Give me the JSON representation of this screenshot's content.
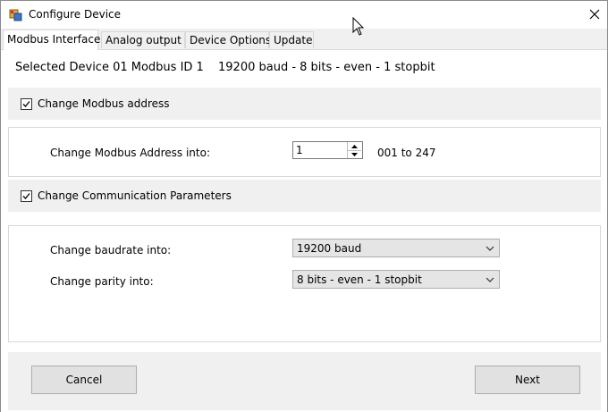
{
  "window": {
    "title": "Configure Device"
  },
  "tabs": [
    {
      "label": "Modbus Interface"
    },
    {
      "label": "Analog output"
    },
    {
      "label": "Device Options"
    },
    {
      "label": "Update"
    }
  ],
  "device": {
    "selected": "Selected Device 01 Modbus ID 1",
    "params": "19200 baud - 8 bits - even - 1 stopbit"
  },
  "address_section": {
    "checkbox_label": "Change Modbus address",
    "checked": true,
    "field_label": "Change Modbus Address into:",
    "value": "1",
    "range_text": "001 to 247"
  },
  "comm_section": {
    "checkbox_label": "Change Communication Parameters",
    "checked": true,
    "baud_label": "Change baudrate into:",
    "baud_value": "19200 baud",
    "parity_label": "Change parity into:",
    "parity_value": "8 bits - even - 1 stopbit"
  },
  "buttons": {
    "cancel": "Cancel",
    "next": "Next"
  },
  "icons": [
    "app-icon",
    "close-icon",
    "checkbox-check-icon",
    "spin-up-icon",
    "spin-down-icon",
    "dropdown-arrow-icon",
    "mouse-cursor-icon"
  ]
}
